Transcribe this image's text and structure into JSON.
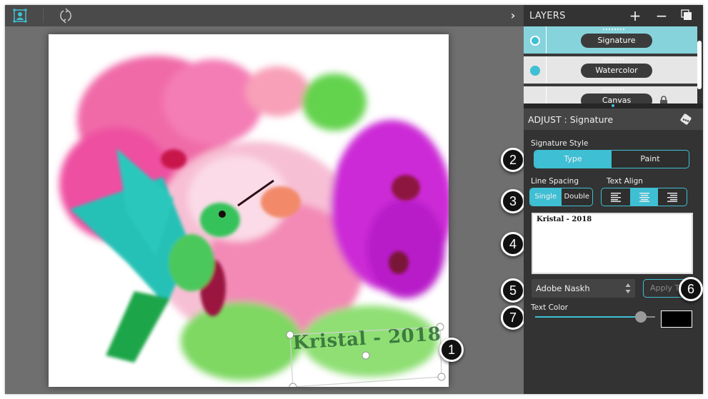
{
  "toolbar": {
    "portrait_tool": "portrait-icon",
    "rotate_tool": "rotate-icon",
    "collapse_icon": "›"
  },
  "canvas": {
    "signature_text": "Kristal - 2018"
  },
  "callouts": [
    "1",
    "2",
    "3",
    "4",
    "5",
    "6",
    "7"
  ],
  "layers": {
    "title": "LAYERS",
    "add_icon": "+",
    "remove_icon": "−",
    "duplicate_icon": "duplicate-icon",
    "items": [
      {
        "name": "Signature",
        "visible": true,
        "selected": true,
        "locked": false
      },
      {
        "name": "Watercolor",
        "visible": true,
        "selected": false,
        "locked": false
      },
      {
        "name": "Canvas",
        "visible": false,
        "selected": false,
        "locked": true
      }
    ]
  },
  "adjust": {
    "title": "ADJUST : Signature",
    "random_icon": "dice-icon",
    "signature_style": {
      "label": "Signature Style",
      "options": [
        "Type",
        "Paint"
      ],
      "selected": "Type"
    },
    "line_spacing": {
      "label": "Line Spacing",
      "options": [
        "Single",
        "Double"
      ],
      "selected": "Single"
    },
    "text_align": {
      "label": "Text Align",
      "options": [
        "left",
        "center",
        "right"
      ],
      "selected": "center"
    },
    "text_value": "Kristal - 2018",
    "font": "Adobe Naskh",
    "apply_button": "Apply Text",
    "text_color": {
      "label": "Text Color",
      "slider_value": 0.88,
      "swatch": "#000000"
    }
  },
  "colors": {
    "accent": "#3fbfd4",
    "selected_row": "#86d3dc",
    "row": "#e6e6e6",
    "panel": "#333333",
    "toolbar": "#4a4a4a",
    "workspace": "#6f6f6f"
  }
}
